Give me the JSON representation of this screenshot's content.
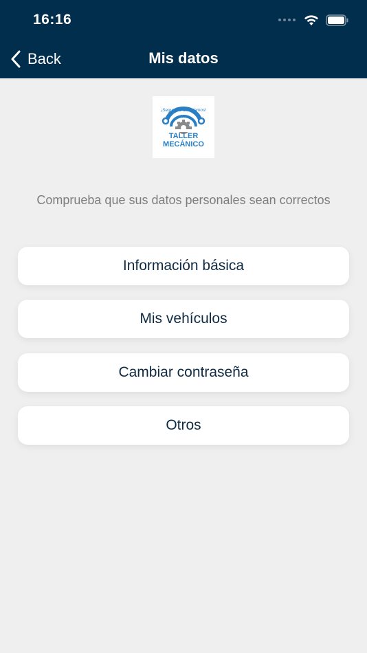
{
  "status_bar": {
    "time": "16:16"
  },
  "nav": {
    "back_label": "Back",
    "title": "Mis datos"
  },
  "logo": {
    "tagline": "¡Seguro lo arreglamos!",
    "line1": "TALLER",
    "line2": "MECÁNICO"
  },
  "subtitle": "Comprueba que sus datos personales sean correctos",
  "menu": {
    "items": [
      {
        "label": "Información básica"
      },
      {
        "label": "Mis vehículos"
      },
      {
        "label": "Cambiar contraseña"
      },
      {
        "label": "Otros"
      }
    ]
  },
  "colors": {
    "header": "#022e4d",
    "background": "#efefef",
    "button_text": "#0f2b44",
    "logo_blue": "#2a7fc4",
    "logo_gear": "#8a8a8a"
  },
  "icons": [
    "chevron-left-icon",
    "signal-icon",
    "wifi-icon",
    "battery-icon"
  ]
}
